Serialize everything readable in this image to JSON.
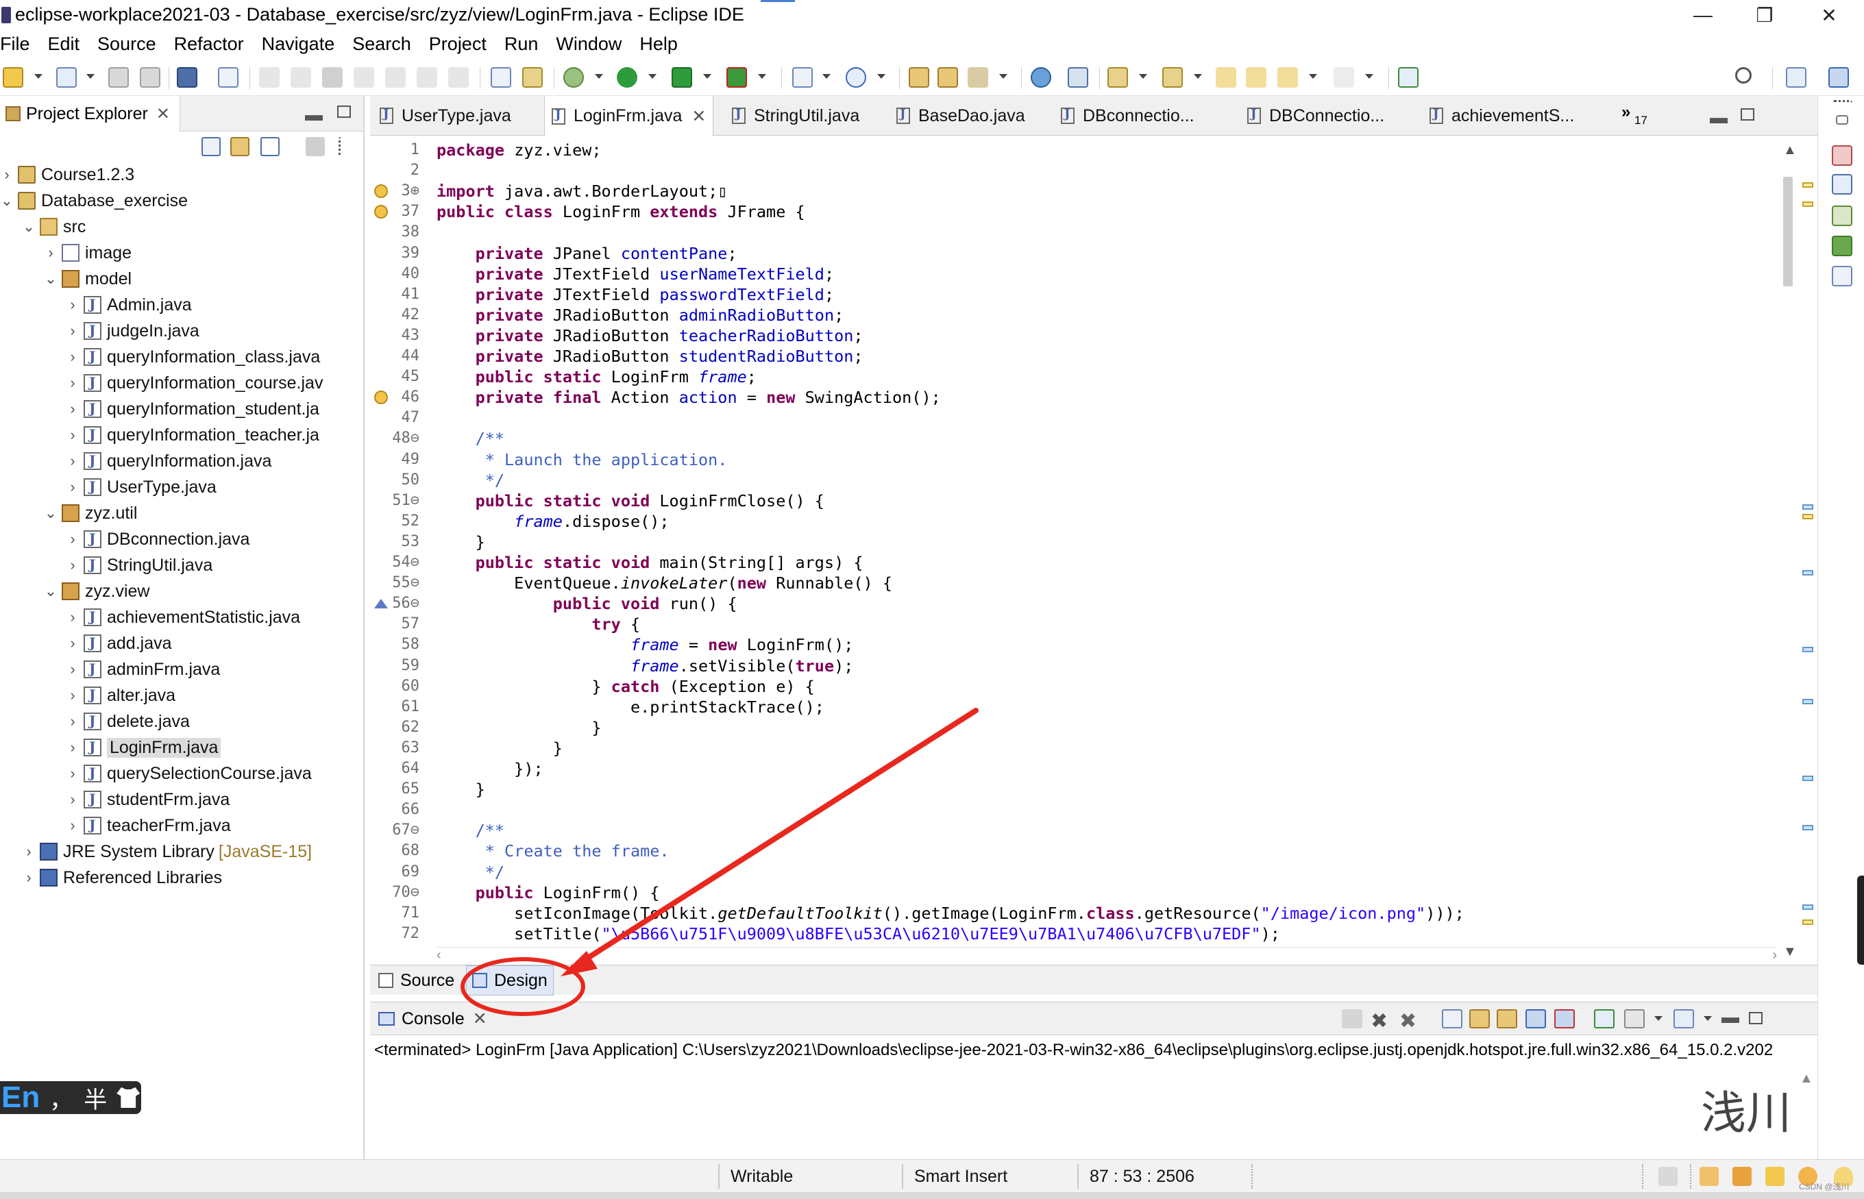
{
  "window": {
    "title": "eclipse-workplace2021-03 - Database_exercise/src/zyz/view/LoginFrm.java - Eclipse IDE",
    "controls": {
      "minimize": "—",
      "restore": "❐",
      "close": "✕"
    }
  },
  "menu": [
    "File",
    "Edit",
    "Source",
    "Refactor",
    "Navigate",
    "Search",
    "Project",
    "Run",
    "Window",
    "Help"
  ],
  "project_explorer": {
    "tab_label": "Project Explorer",
    "tree": [
      {
        "label": "Course1.2.3",
        "icon": "project-icon",
        "arrow": "›",
        "level": 0
      },
      {
        "label": "Database_exercise",
        "icon": "project-icon",
        "arrow": "⌄",
        "level": 0
      },
      {
        "label": "src",
        "icon": "source-folder-icon",
        "arrow": "⌄",
        "level": 1
      },
      {
        "label": "image",
        "icon": "image-package-icon",
        "arrow": "›",
        "level": 2
      },
      {
        "label": "model",
        "icon": "package-icon",
        "arrow": "⌄",
        "level": 2
      },
      {
        "label": "Admin.java",
        "icon": "java-file-icon",
        "arrow": "›",
        "level": 3
      },
      {
        "label": "judgeIn.java",
        "icon": "java-file-icon",
        "arrow": "›",
        "level": 3
      },
      {
        "label": "queryInformation_class.java",
        "icon": "java-file-icon",
        "arrow": "›",
        "level": 3
      },
      {
        "label": "queryInformation_course.jav",
        "icon": "java-file-icon",
        "arrow": "›",
        "level": 3
      },
      {
        "label": "queryInformation_student.ja",
        "icon": "java-file-icon",
        "arrow": "›",
        "level": 3
      },
      {
        "label": "queryInformation_teacher.ja",
        "icon": "java-file-icon",
        "arrow": "›",
        "level": 3
      },
      {
        "label": "queryInformation.java",
        "icon": "java-file-icon",
        "arrow": "›",
        "level": 3
      },
      {
        "label": "UserType.java",
        "icon": "java-file-icon",
        "arrow": "›",
        "level": 3
      },
      {
        "label": "zyz.util",
        "icon": "package-icon",
        "arrow": "⌄",
        "level": 2
      },
      {
        "label": "DBconnection.java",
        "icon": "java-file-icon",
        "arrow": "›",
        "level": 3
      },
      {
        "label": "StringUtil.java",
        "icon": "java-file-icon",
        "arrow": "›",
        "level": 3
      },
      {
        "label": "zyz.view",
        "icon": "package-icon",
        "arrow": "⌄",
        "level": 2
      },
      {
        "label": "achievementStatistic.java",
        "icon": "java-file-icon",
        "arrow": "›",
        "level": 3
      },
      {
        "label": "add.java",
        "icon": "java-file-icon",
        "arrow": "›",
        "level": 3
      },
      {
        "label": "adminFrm.java",
        "icon": "java-file-icon",
        "arrow": "›",
        "level": 3
      },
      {
        "label": "alter.java",
        "icon": "java-file-icon",
        "arrow": "›",
        "level": 3
      },
      {
        "label": "delete.java",
        "icon": "java-file-icon",
        "arrow": "›",
        "level": 3
      },
      {
        "label": "LoginFrm.java",
        "icon": "java-file-icon",
        "arrow": "›",
        "level": 3,
        "selected": true
      },
      {
        "label": "querySelectionCourse.java",
        "icon": "java-file-icon",
        "arrow": "›",
        "level": 3
      },
      {
        "label": "studentFrm.java",
        "icon": "java-file-icon",
        "arrow": "›",
        "level": 3
      },
      {
        "label": "teacherFrm.java",
        "icon": "java-file-icon",
        "arrow": "›",
        "level": 3
      },
      {
        "label": "JRE System Library",
        "decor": "[JavaSE-15]",
        "icon": "library-icon",
        "arrow": "›",
        "level": 1
      },
      {
        "label": "Referenced Libraries",
        "icon": "library-icon",
        "arrow": "›",
        "level": 1
      }
    ]
  },
  "editor": {
    "tabs": [
      {
        "label": "UserType.java",
        "active": false
      },
      {
        "label": "LoginFrm.java",
        "active": true
      },
      {
        "label": "StringUtil.java",
        "active": false
      },
      {
        "label": "BaseDao.java",
        "active": false
      },
      {
        "label": "DBconnectio...",
        "active": false
      },
      {
        "label": "DBConnectio...",
        "active": false
      },
      {
        "label": "achievementS...",
        "active": false
      }
    ],
    "overflow_label": "»",
    "overflow_count": "17",
    "lines": [
      {
        "n": "1",
        "html": "<span class='kw'>package</span> zyz.view;"
      },
      {
        "n": "2",
        "html": ""
      },
      {
        "n": "3⊕",
        "mark": "warn",
        "html": "<span class='kw'>import</span> java.awt.BorderLayout;▯"
      },
      {
        "n": "37",
        "mark": "warn",
        "html": "<span class='kw'>public class</span> LoginFrm <span class='kw'>extends</span> JFrame {"
      },
      {
        "n": "38",
        "html": ""
      },
      {
        "n": "39",
        "html": "    <span class='kw'>private</span> JPanel <span class='fld'>contentPane</span>;"
      },
      {
        "n": "40",
        "html": "    <span class='kw'>private</span> JTextField <span class='fld'>userNameTextField</span>;"
      },
      {
        "n": "41",
        "html": "    <span class='kw'>private</span> JTextField <span class='fld'>passwordTextField</span>;"
      },
      {
        "n": "42",
        "html": "    <span class='kw'>private</span> JRadioButton <span class='fld'>adminRadioButton</span>;"
      },
      {
        "n": "43",
        "html": "    <span class='kw'>private</span> JRadioButton <span class='fld'>teacherRadioButton</span>;"
      },
      {
        "n": "44",
        "html": "    <span class='kw'>private</span> JRadioButton <span class='fld'>studentRadioButton</span>;"
      },
      {
        "n": "45",
        "html": "    <span class='kw'>public static</span> LoginFrm <span class='sfld'>frame</span>;"
      },
      {
        "n": "46",
        "mark": "warn",
        "html": "    <span class='kw'>private final</span> Action <span class='fld'>action</span> = <span class='kw'>new</span> SwingAction();"
      },
      {
        "n": "47",
        "html": ""
      },
      {
        "n": "48⊖",
        "html": "    <span class='cmt'>/**</span>"
      },
      {
        "n": "49",
        "html": "<span class='cmt'>     * Launch the application.</span>"
      },
      {
        "n": "50",
        "html": "<span class='cmt'>     */</span>"
      },
      {
        "n": "51⊖",
        "html": "    <span class='kw'>public static void</span> LoginFrmClose() {"
      },
      {
        "n": "52",
        "html": "        <span class='sfld'>frame</span>.dispose();"
      },
      {
        "n": "53",
        "html": "    }"
      },
      {
        "n": "54⊖",
        "html": "    <span class='kw'>public static void</span> main(String[] args) {"
      },
      {
        "n": "55⊖",
        "html": "        EventQueue.<span class='mth'>invokeLater</span>(<span class='kw'>new</span> Runnable() {"
      },
      {
        "n": "56⊖",
        "mark": "override",
        "html": "            <span class='kw'>public void</span> run() {"
      },
      {
        "n": "57",
        "html": "                <span class='kw'>try</span> {"
      },
      {
        "n": "58",
        "html": "                    <span class='sfld'>frame</span> = <span class='kw'>new</span> LoginFrm();"
      },
      {
        "n": "59",
        "html": "                    <span class='sfld'>frame</span>.setVisible(<span class='kw'>true</span>);"
      },
      {
        "n": "60",
        "html": "                } <span class='kw'>catch</span> (Exception e) {"
      },
      {
        "n": "61",
        "html": "                    e.printStackTrace();"
      },
      {
        "n": "62",
        "html": "                }"
      },
      {
        "n": "63",
        "html": "            }"
      },
      {
        "n": "64",
        "html": "        });"
      },
      {
        "n": "65",
        "html": "    }"
      },
      {
        "n": "66",
        "html": ""
      },
      {
        "n": "67⊖",
        "html": "    <span class='cmt'>/**</span>"
      },
      {
        "n": "68",
        "html": "<span class='cmt'>     * Create the frame.</span>"
      },
      {
        "n": "69",
        "html": "<span class='cmt'>     */</span>"
      },
      {
        "n": "70⊖",
        "html": "    <span class='kw'>public</span> LoginFrm() {"
      },
      {
        "n": "71",
        "html": "        setIconImage(Toolkit.<span class='mth'>getDefaultToolkit</span>().getImage(LoginFrm.<span class='kw'>class</span>.getResource(<span class='str'>\"/image/icon.png\"</span>)));"
      },
      {
        "n": "72",
        "html": "        setTitle(<span class='str'>\"\\u5B66\\u751F\\u9009\\u8BFE\\u53CA\\u6210\\u7EE9\\u7BA1\\u7406\\u7CFB\\u7EDF\"</span>);"
      }
    ],
    "bottom_tabs": {
      "source": "Source",
      "design": "Design"
    }
  },
  "console": {
    "tab_label": "Console",
    "status": "<terminated> LoginFrm [Java Application] C:\\Users\\zyz2021\\Downloads\\eclipse-jee-2021-03-R-win32-x86_64\\eclipse\\plugins\\org.eclipse.justj.openjdk.hotspot.jre.full.win32.x86_64_15.0.2.v202",
    "watermark": "浅川"
  },
  "ime": {
    "lang": "En",
    "punct": "，",
    "width": "半"
  },
  "statusbar": {
    "writable": "Writable",
    "insert_mode": "Smart Insert",
    "position": "87 : 53 : 2506",
    "watermark": "CSDN @浅川"
  },
  "colors": {
    "annotation": "#e8281e",
    "keyword": "#7f0055",
    "field": "#0000c0",
    "comment": "#3f5fbf",
    "string": "#2a00ff"
  }
}
